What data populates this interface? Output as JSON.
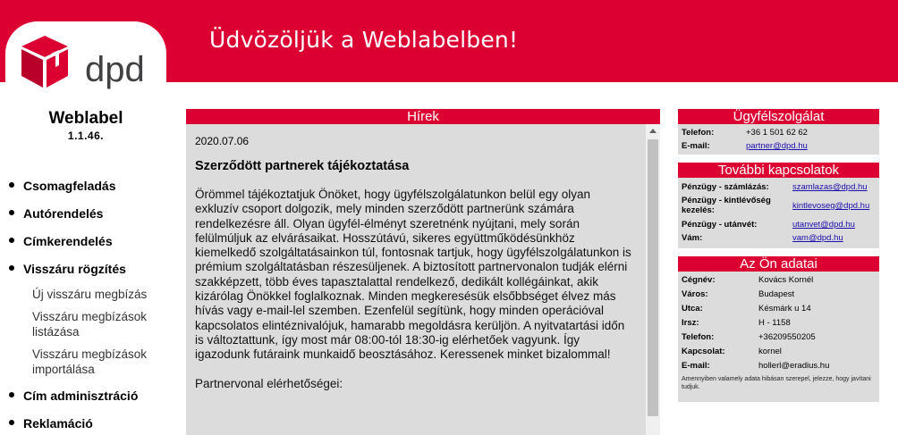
{
  "header": {
    "welcome": "Üdvözöljük a Weblabelben!"
  },
  "brand": {
    "logo_text": "dpd",
    "logo_color": "#dc0032",
    "accent_color": "#dc0032",
    "app_name": "Weblabel",
    "version": "1.1.46."
  },
  "nav": {
    "items": [
      {
        "label": "Csomagfeladás"
      },
      {
        "label": "Autórendelés"
      },
      {
        "label": "Címkerendelés"
      },
      {
        "label": "Visszáru rögzítés"
      },
      {
        "label": "Cím adminisztráció"
      },
      {
        "label": "Reklamáció"
      }
    ],
    "subitems": [
      {
        "label": "Új visszáru megbízás"
      },
      {
        "label": "Visszáru megbízások listázása"
      },
      {
        "label": "Visszáru megbízások importálása"
      }
    ]
  },
  "news": {
    "heading": "Hírek",
    "date": "2020.07.06",
    "title": "Szerződött partnerek tájékoztatása",
    "body": "Örömmel tájékoztatjuk Önöket, hogy ügyfélszolgálatunkon belül egy olyan exkluzív csoport dolgozik, mely minden szerződött partnerünk számára rendelkezésre áll. Olyan ügyfél-élményt szeretnénk nyújtani, mely során felülmúljuk az elvárásaikat. Hosszútávú, sikeres együttműködésünkhöz kiemelkedő szolgáltatásainkon túl, fontosnak tartjuk, hogy ügyfélszolgálatunkon is prémium szolgáltatásban részesüljenek. A biztosított partnervonalon tudják elérni szakképzett, több éves tapasztalattal rendelkező, dedikált kollégáinkat, akik kizárólag Önökkel foglalkoznak. Minden megkeresésük elsőbbséget élvez más hívás vagy e-mail-lel szemben. Ezenfelül segítünk, hogy minden operációval kapcsolatos elintéznivalójuk, hamarabb megoldásra kerüljön. A nyitvatartási időn is változtattunk, így most már 08:00-tól 18:30-ig elérhetőek vagyunk. Így igazodunk futáraink munkaidő beosztásához. Keressenek minket bizalommal!",
    "contact_heading": "Partnervonal elérhetőségei:"
  },
  "customer_service": {
    "heading": "Ügyfélszolgálat",
    "rows": [
      {
        "label": "Telefon:",
        "value": "+36 1 501 62 62"
      },
      {
        "label": "E-mail:",
        "value": "partner@dpd.hu"
      }
    ]
  },
  "contacts": {
    "heading": "További kapcsolatok",
    "rows": [
      {
        "label": "Pénzügy - számlázás:",
        "value": "szamlazas@dpd.hu"
      },
      {
        "label": "Pénzügy - kintlévőség",
        "label2": "kezelés:",
        "value": "kintlevoseg@dpd.hu"
      },
      {
        "label": "Pénzügy - utánvét:",
        "value": "utanvet@dpd.hu"
      },
      {
        "label": "Vám:",
        "value": "vam@dpd.hu"
      }
    ]
  },
  "user_data": {
    "heading": "Az Ön adatai",
    "rows": [
      {
        "label": "Cégnév:",
        "value": "Kovács Kornél"
      },
      {
        "label": "Város:",
        "value": "Budapest"
      },
      {
        "label": "Utca:",
        "value": "Késmárk u 14"
      },
      {
        "label": "Irsz:",
        "value": "H - 1158"
      },
      {
        "label": "Telefon:",
        "value": "+36209550205"
      },
      {
        "label": "Kapcsolat:",
        "value": "kornel"
      },
      {
        "label": "E-mail:",
        "value": "hollerl@eradius.hu"
      }
    ],
    "note": "Amennyiben valamely adata hibásan szerepel, jelezze, hogy javítani tudjuk."
  }
}
